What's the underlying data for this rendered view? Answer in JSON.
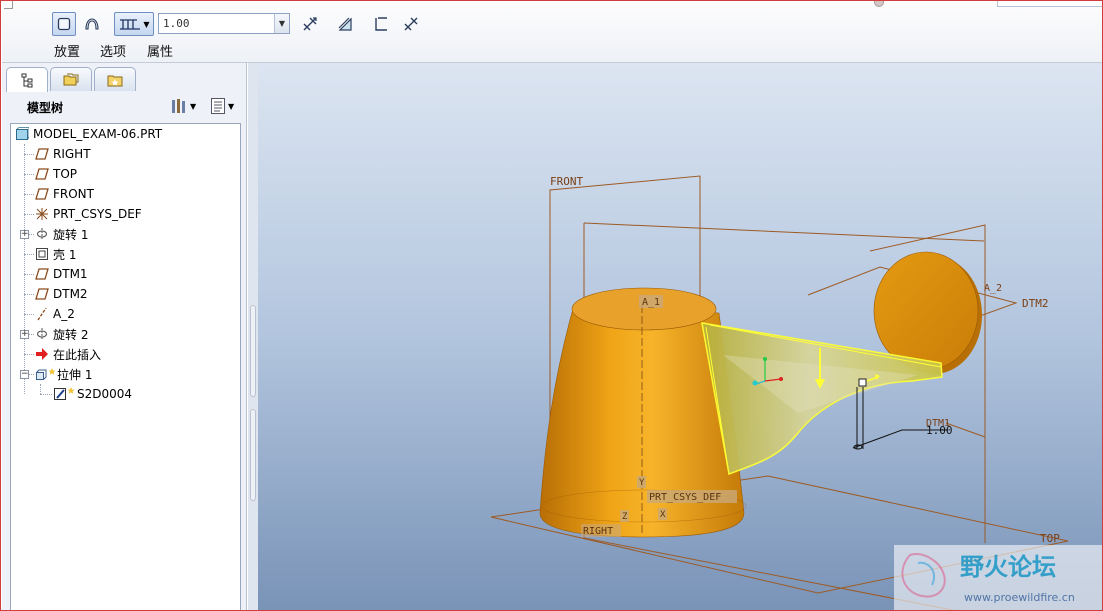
{
  "dashboard": {
    "depth_value": "1.00",
    "tabs": [
      "放置",
      "选项",
      "属性"
    ]
  },
  "model_tree": {
    "title": "模型树",
    "items": [
      {
        "label": "MODEL_EXAM-06.PRT",
        "icon": "part-icon"
      },
      {
        "label": "RIGHT",
        "icon": "datum-plane-icon"
      },
      {
        "label": "TOP",
        "icon": "datum-plane-icon"
      },
      {
        "label": "FRONT",
        "icon": "datum-plane-icon"
      },
      {
        "label": "PRT_CSYS_DEF",
        "icon": "csys-icon"
      },
      {
        "label": "旋转 1",
        "icon": "revolve-icon"
      },
      {
        "label": "壳 1",
        "icon": "shell-icon"
      },
      {
        "label": "DTM1",
        "icon": "datum-plane-icon"
      },
      {
        "label": "DTM2",
        "icon": "datum-plane-icon"
      },
      {
        "label": "A_2",
        "icon": "datum-axis-icon"
      },
      {
        "label": "旋转 2",
        "icon": "revolve-icon"
      },
      {
        "label": "在此插入",
        "icon": "insert-here-icon"
      },
      {
        "label": "拉伸 1",
        "icon": "extrude-icon"
      },
      {
        "label": "S2D0004",
        "icon": "sketch-icon"
      }
    ]
  },
  "viewport": {
    "labels": {
      "front": "FRONT",
      "a1": "A_1",
      "a2": "A_2",
      "dtm2": "DTM2",
      "dtm1": "DTM1",
      "csys": "PRT_CSYS_DEF",
      "right": "RIGHT",
      "top": "TOP",
      "dimension": "1.00",
      "csys_x": "X",
      "csys_z": "Z",
      "csys_y": "Y"
    },
    "colors": {
      "solid": "#e69a12",
      "datum": "#9c5b25",
      "preview": "#c8c43a",
      "highlight": "#ffff33"
    }
  },
  "watermark": {
    "title": "野火论坛",
    "url": "www.proewildfire.cn"
  }
}
